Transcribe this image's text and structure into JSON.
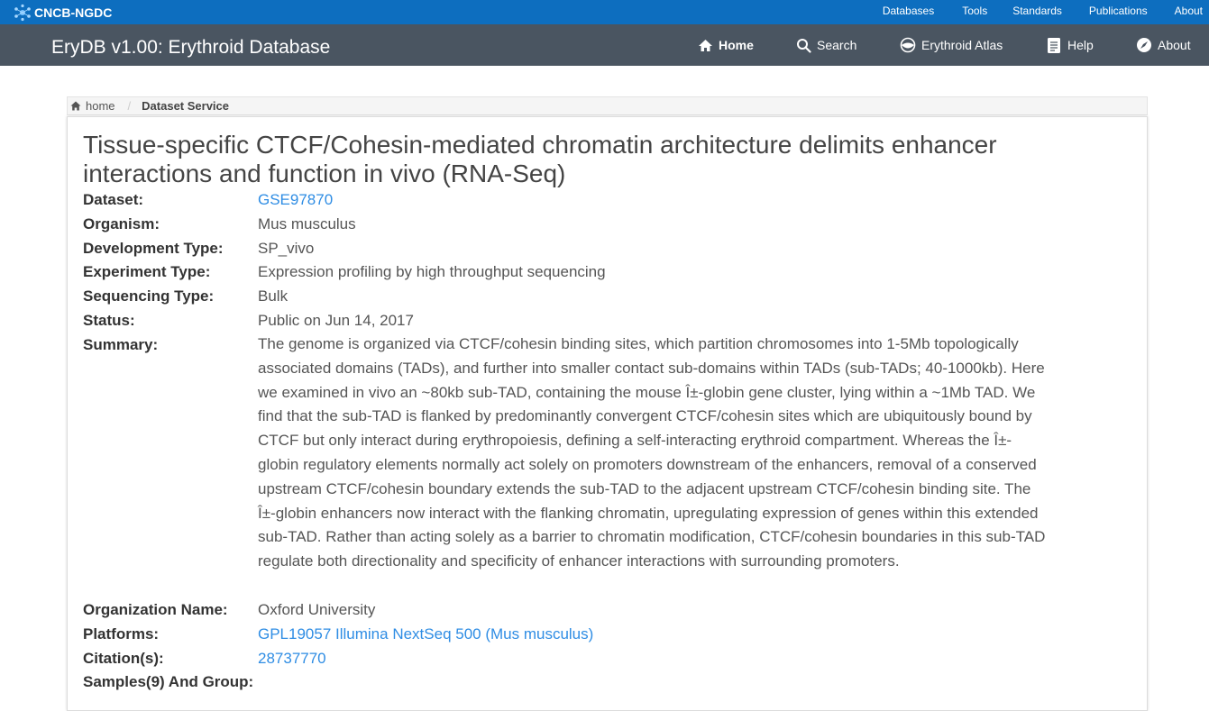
{
  "topbar": {
    "brand": "CNCB-NGDC",
    "links": [
      "Databases",
      "Tools",
      "Standards",
      "Publications",
      "About"
    ]
  },
  "navbar": {
    "title": "EryDB v1.00: Erythroid Database",
    "items": {
      "home": "Home",
      "search": "Search",
      "atlas": "Erythroid Atlas",
      "help": "Help",
      "about": "About"
    }
  },
  "breadcrumb": {
    "home": "home",
    "current": "Dataset Service"
  },
  "dataset": {
    "title": "Tissue-specific CTCF/Cohesin-mediated chromatin architecture delimits enhancer interactions and function in vivo (RNA-Seq)",
    "labels": {
      "dataset": "Dataset:",
      "organism": "Organism:",
      "development_type": "Development Type:",
      "experiment_type": "Experiment Type:",
      "sequencing_type": "Sequencing Type:",
      "status": "Status:",
      "summary": "Summary:",
      "organization": "Organization Name:",
      "platforms": "Platforms:",
      "citations": "Citation(s):",
      "samples": "Samples(9) And Group:"
    },
    "values": {
      "dataset": "GSE97870",
      "organism": "Mus musculus",
      "development_type": "SP_vivo",
      "experiment_type": "Expression profiling by high throughput sequencing",
      "sequencing_type": "Bulk",
      "status": "Public on Jun 14, 2017",
      "summary": "The genome is organized via CTCF/cohesin binding sites, which partition chromosomes into 1-5Mb topologically associated domains (TADs), and further into smaller contact sub-domains within TADs (sub-TADs; 40-1000kb). Here we examined in vivo an ~80kb sub-TAD, containing the mouse Î±-globin gene cluster, lying within a ~1Mb TAD. We find that the sub-TAD is flanked by predominantly convergent CTCF/cohesin sites which are ubiquitously bound by CTCF but only interact during erythropoiesis, defining a self-interacting erythroid compartment. Whereas the Î±-globin regulatory elements normally act solely on promoters downstream of the enhancers, removal of a conserved upstream CTCF/cohesin boundary extends the sub-TAD to the adjacent upstream CTCF/cohesin binding site. The Î±-globin enhancers now interact with the flanking chromatin, upregulating expression of genes within this extended sub-TAD. Rather than acting solely as a barrier to chromatin modification, CTCF/cohesin boundaries in this sub-TAD regulate both directionality and specificity of enhancer interactions with surrounding promoters.",
      "organization": "Oxford University",
      "platforms": "GPL19057 Illumina NextSeq 500 (Mus musculus)",
      "citations": "28737770"
    }
  }
}
